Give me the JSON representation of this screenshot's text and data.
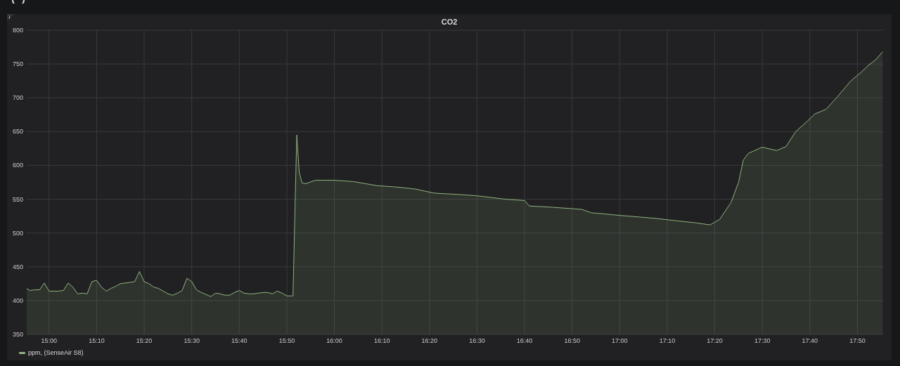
{
  "panel": {
    "chart_data": {
      "type": "area",
      "title": "CO2",
      "x": [
        895.3,
        896,
        897,
        898,
        899,
        900,
        902,
        903,
        904,
        905,
        906,
        907,
        908,
        909,
        910,
        911,
        912,
        913,
        914,
        915,
        916,
        917,
        918,
        919,
        920,
        921,
        922,
        923,
        924,
        925,
        926,
        927,
        928,
        929,
        930,
        931,
        932,
        933,
        934,
        935,
        936,
        937,
        938,
        939,
        940,
        941,
        942,
        943,
        944,
        945,
        946,
        947,
        948,
        949,
        950,
        951,
        951.3,
        951.8,
        952.1,
        952.6,
        953.2,
        954,
        956,
        960,
        964,
        969,
        973,
        977,
        981,
        986,
        990,
        996,
        1000,
        1001,
        1006,
        1012,
        1014,
        1020,
        1027,
        1032,
        1036,
        1039,
        1041,
        1043.4,
        1045,
        1046,
        1047.1,
        1050,
        1053,
        1055,
        1057,
        1059.4,
        1061,
        1063.4,
        1065.6,
        1068.6,
        1070.8,
        1072.3,
        1073.8,
        1075.3
      ],
      "series": [
        {
          "name": "ppm, (SenseAir S8)",
          "color": "#8fb37a",
          "values": [
            418,
            415,
            416,
            416,
            426,
            414,
            414,
            415,
            426,
            420,
            410,
            411,
            410,
            428,
            430,
            420,
            414,
            418,
            421,
            425,
            426,
            427,
            428,
            443,
            428,
            425,
            420,
            418,
            414,
            410,
            408,
            411,
            415,
            433,
            428,
            416,
            412,
            409,
            406,
            411,
            410,
            408,
            408,
            412,
            415,
            411,
            410,
            410,
            411,
            412,
            412,
            410,
            414,
            411,
            407,
            407,
            407,
            560,
            645,
            590,
            574,
            573,
            578,
            578,
            576,
            570,
            568,
            565,
            559,
            557,
            555,
            550,
            548,
            540,
            538,
            535,
            530,
            526,
            522,
            518,
            515,
            512,
            520,
            545,
            575,
            608,
            618,
            627,
            622,
            628,
            650,
            665,
            676,
            683,
            700,
            725,
            738,
            748,
            756,
            768
          ]
        }
      ],
      "grid": true,
      "xlim": [
        895.3,
        1075.4
      ],
      "ylim": [
        350,
        800
      ],
      "xticks": [
        {
          "value": 900,
          "label": "15:00"
        },
        {
          "value": 910,
          "label": "15:10"
        },
        {
          "value": 920,
          "label": "15:20"
        },
        {
          "value": 930,
          "label": "15:30"
        },
        {
          "value": 940,
          "label": "15:40"
        },
        {
          "value": 950,
          "label": "15:50"
        },
        {
          "value": 960,
          "label": "16:00"
        },
        {
          "value": 970,
          "label": "16:10"
        },
        {
          "value": 980,
          "label": "16:20"
        },
        {
          "value": 990,
          "label": "16:30"
        },
        {
          "value": 1000,
          "label": "16:40"
        },
        {
          "value": 1010,
          "label": "16:50"
        },
        {
          "value": 1020,
          "label": "17:00"
        },
        {
          "value": 1030,
          "label": "17:10"
        },
        {
          "value": 1040,
          "label": "17:20"
        },
        {
          "value": 1050,
          "label": "17:30"
        },
        {
          "value": 1060,
          "label": "17:40"
        },
        {
          "value": 1070,
          "label": "17:50"
        }
      ],
      "yticks": [
        350,
        400,
        450,
        500,
        550,
        600,
        650,
        700,
        750,
        800
      ]
    }
  }
}
